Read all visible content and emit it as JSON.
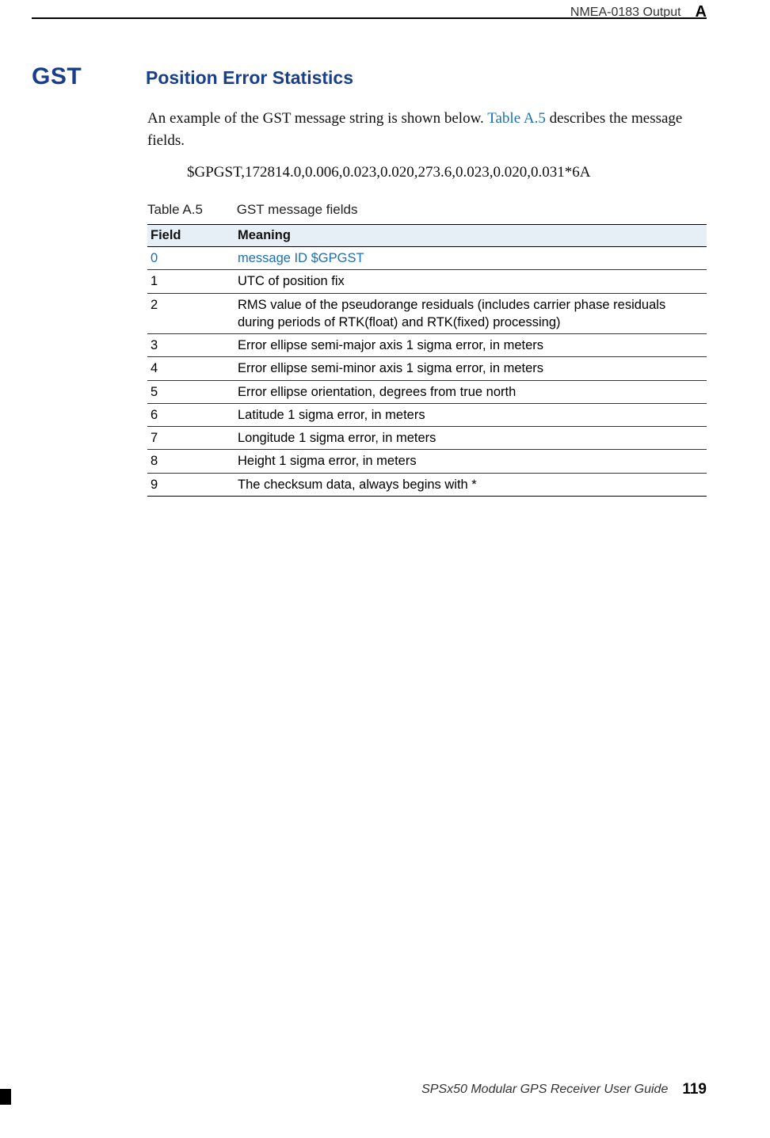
{
  "header": {
    "section": "NMEA-0183 Output",
    "appendix_letter": "A"
  },
  "heading": {
    "label": "GST",
    "title": "Position Error Statistics"
  },
  "intro": {
    "pre": "An example of the GST message string is shown below. ",
    "link": "Table A.5",
    "post": " describes the message fields."
  },
  "example": "$GPGST,172814.0,0.006,0.023,0.020,273.6,0.023,0.020,0.031*6A",
  "table": {
    "caption_num": "Table A.5",
    "caption_title": "GST message fields",
    "columns": {
      "field": "Field",
      "meaning": "Meaning"
    },
    "rows": [
      {
        "field": "0",
        "meaning": "message ID $GPGST",
        "highlight": true
      },
      {
        "field": "1",
        "meaning": "UTC of position fix"
      },
      {
        "field": "2",
        "meaning": "RMS value of the pseudorange residuals (includes carrier phase residuals during periods of RTK(float) and RTK(fixed) processing)"
      },
      {
        "field": "3",
        "meaning": "Error ellipse semi-major axis 1 sigma error, in meters"
      },
      {
        "field": "4",
        "meaning": "Error ellipse semi-minor axis 1 sigma error, in meters"
      },
      {
        "field": "5",
        "meaning": "Error ellipse orientation, degrees from true north"
      },
      {
        "field": "6",
        "meaning": "Latitude 1 sigma error, in meters"
      },
      {
        "field": "7",
        "meaning": "Longitude 1 sigma error, in meters"
      },
      {
        "field": "8",
        "meaning": "Height 1 sigma error, in meters"
      },
      {
        "field": "9",
        "meaning": "The checksum data, always begins with *"
      }
    ]
  },
  "footer": {
    "title": "SPSx50 Modular GPS Receiver User Guide",
    "page": "119"
  }
}
